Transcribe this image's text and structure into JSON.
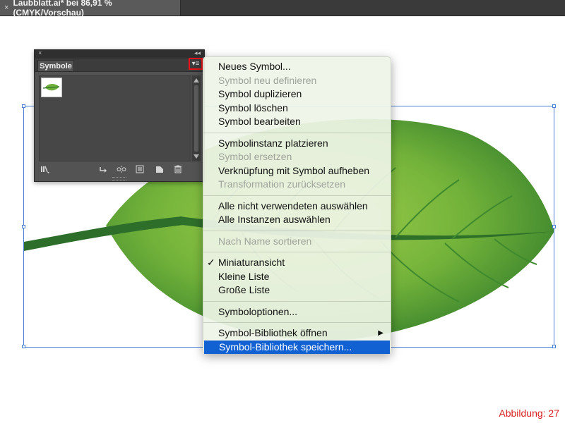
{
  "document_tab": {
    "close_glyph": "×",
    "title": "Laubblatt.ai* bei 86,91 % (CMYK/Vorschau)"
  },
  "panel": {
    "tab_label": "Symbole",
    "close_glyph": "×",
    "collapse_glyph": "◂◂",
    "menu_glyph": "▾≡",
    "symbols": [
      {
        "icon": "leaf-icon"
      }
    ],
    "bottom_icons": [
      "library-menu-icon",
      "place-symbol-icon",
      "break-link-icon",
      "symbol-options-icon",
      "new-symbol-icon",
      "delete-icon"
    ]
  },
  "menu": {
    "groups": [
      [
        {
          "label": "Neues Symbol...",
          "enabled": true
        },
        {
          "label": "Symbol neu definieren",
          "enabled": false
        },
        {
          "label": "Symbol duplizieren",
          "enabled": true
        },
        {
          "label": "Symbol löschen",
          "enabled": true
        },
        {
          "label": "Symbol bearbeiten",
          "enabled": true
        }
      ],
      [
        {
          "label": "Symbolinstanz platzieren",
          "enabled": true
        },
        {
          "label": "Symbol ersetzen",
          "enabled": false
        },
        {
          "label": "Verknüpfung mit Symbol aufheben",
          "enabled": true
        },
        {
          "label": "Transformation zurücksetzen",
          "enabled": false
        }
      ],
      [
        {
          "label": "Alle nicht verwendeten auswählen",
          "enabled": true
        },
        {
          "label": "Alle Instanzen auswählen",
          "enabled": true
        }
      ],
      [
        {
          "label": "Nach Name sortieren",
          "enabled": false
        }
      ],
      [
        {
          "label": "Miniaturansicht",
          "enabled": true,
          "checked": true
        },
        {
          "label": "Kleine Liste",
          "enabled": true
        },
        {
          "label": "Große Liste",
          "enabled": true
        }
      ],
      [
        {
          "label": "Symboloptionen...",
          "enabled": true
        }
      ],
      [
        {
          "label": "Symbol-Bibliothek öffnen",
          "enabled": true,
          "submenu": true
        },
        {
          "label": "Symbol-Bibliothek speichern...",
          "enabled": true,
          "selected": true
        }
      ]
    ],
    "check_glyph": "✓",
    "submenu_glyph": "▶"
  },
  "caption": "Abbildung: 27",
  "colors": {
    "selection": "#4a7fd8",
    "menu_highlight": "#1261d3",
    "leaf_light": "#8cc63f",
    "leaf_dark": "#2f7a2a",
    "caption": "#d92020"
  }
}
